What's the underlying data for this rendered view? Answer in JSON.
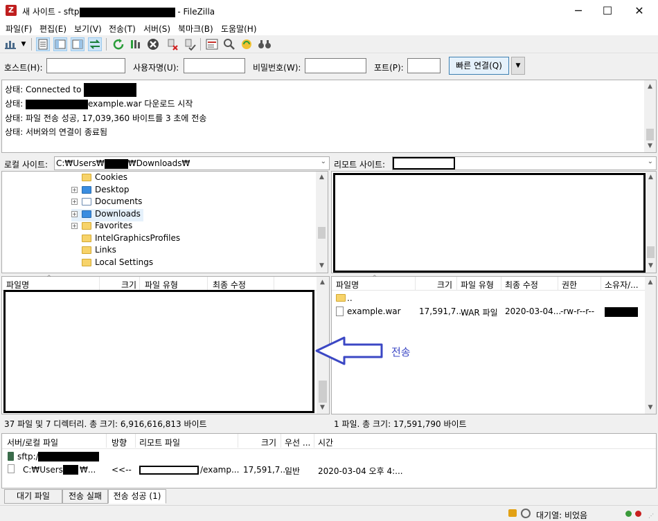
{
  "window": {
    "title_prefix": "새 사이트 - sftp",
    "title_suffix": " - FileZilla",
    "minimize": "─",
    "maximize": "☐",
    "close": "✕"
  },
  "menu": [
    "파일(F)",
    "편집(E)",
    "보기(V)",
    "전송(T)",
    "서버(S)",
    "북마크(B)",
    "도움말(H)"
  ],
  "toolbar_icons": [
    "site-manager-icon",
    "dropdown-arrow-icon",
    "message-log-icon",
    "local-tree-icon",
    "remote-tree-icon",
    "transfer-queue-icon",
    "refresh-icon",
    "process-queue-icon",
    "cancel-icon",
    "disconnect-icon",
    "reconnect-icon",
    "directory-listing-filters-icon",
    "compare-icon",
    "sync-browse-icon",
    "search-icon"
  ],
  "quickconnect": {
    "host_label": "호스트(H):",
    "user_label": "사용자명(U):",
    "pass_label": "비밀번호(W):",
    "port_label": "포트(P):",
    "connect_label": "빠른 연결(Q)",
    "dropdown": "▼"
  },
  "log": [
    {
      "prefix": "상태:",
      "text": "Connected to",
      "redact": true
    },
    {
      "prefix": "상태:",
      "text": "example.war 다운로드 시작",
      "redact_before": true
    },
    {
      "prefix": "상태:",
      "text": "파일 전송 성공, 17,039,360 바이트를 3 초에 전송"
    },
    {
      "prefix": "상태:",
      "text": "서버와의 연결이 종료됨"
    }
  ],
  "local": {
    "label": "로컬 사이트:",
    "path_prefix": "C:₩Users₩",
    "path_suffix": "₩Downloads₩",
    "tree": [
      {
        "name": "Cookies",
        "expandable": false
      },
      {
        "name": "Desktop",
        "expandable": true
      },
      {
        "name": "Documents",
        "expandable": true
      },
      {
        "name": "Downloads",
        "expandable": true
      },
      {
        "name": "Favorites",
        "expandable": true
      },
      {
        "name": "IntelGraphicsProfiles",
        "expandable": false
      },
      {
        "name": "Links",
        "expandable": false
      },
      {
        "name": "Local Settings",
        "expandable": false
      }
    ],
    "columns": [
      "파일명",
      "크기",
      "파일 유형",
      "최종 수정"
    ],
    "status": "37 파일 및 7 디렉터리. 총 크기: 6,916,616,813 바이트"
  },
  "remote": {
    "label": "리모트 사이트:",
    "columns": [
      "파일명",
      "크기",
      "파일 유형",
      "최종 수정",
      "권한",
      "소유자/..."
    ],
    "files": [
      {
        "name": "..",
        "size": "",
        "type": "",
        "modified": "",
        "perms": ""
      },
      {
        "name": "example.war",
        "size": "17,591,7...",
        "type": "WAR 파일",
        "modified": "2020-03-04...",
        "perms": "-rw-r--r--"
      }
    ],
    "status": "1 파일. 총 크기: 17,591,790 바이트"
  },
  "annotation": {
    "label": "전송",
    "color": "#3b47c4"
  },
  "queue": {
    "columns": [
      "서버/로컬 파일",
      "방향",
      "리모트 파일",
      "크기",
      "우선 ...",
      "시간"
    ],
    "server": "sftp:/",
    "row": {
      "local": "C:₩Users₩",
      "local_tail": "₩...",
      "direction": "<<--",
      "remote_tail": "/examp...",
      "size": "17,591,7...",
      "priority": "일반",
      "time": "2020-03-04 오후 4:..."
    }
  },
  "tabs": [
    "대기 파일",
    "전송 실패",
    "전송 성공 (1)"
  ],
  "statusbar": {
    "queue_text": "대기열: 비었음"
  }
}
